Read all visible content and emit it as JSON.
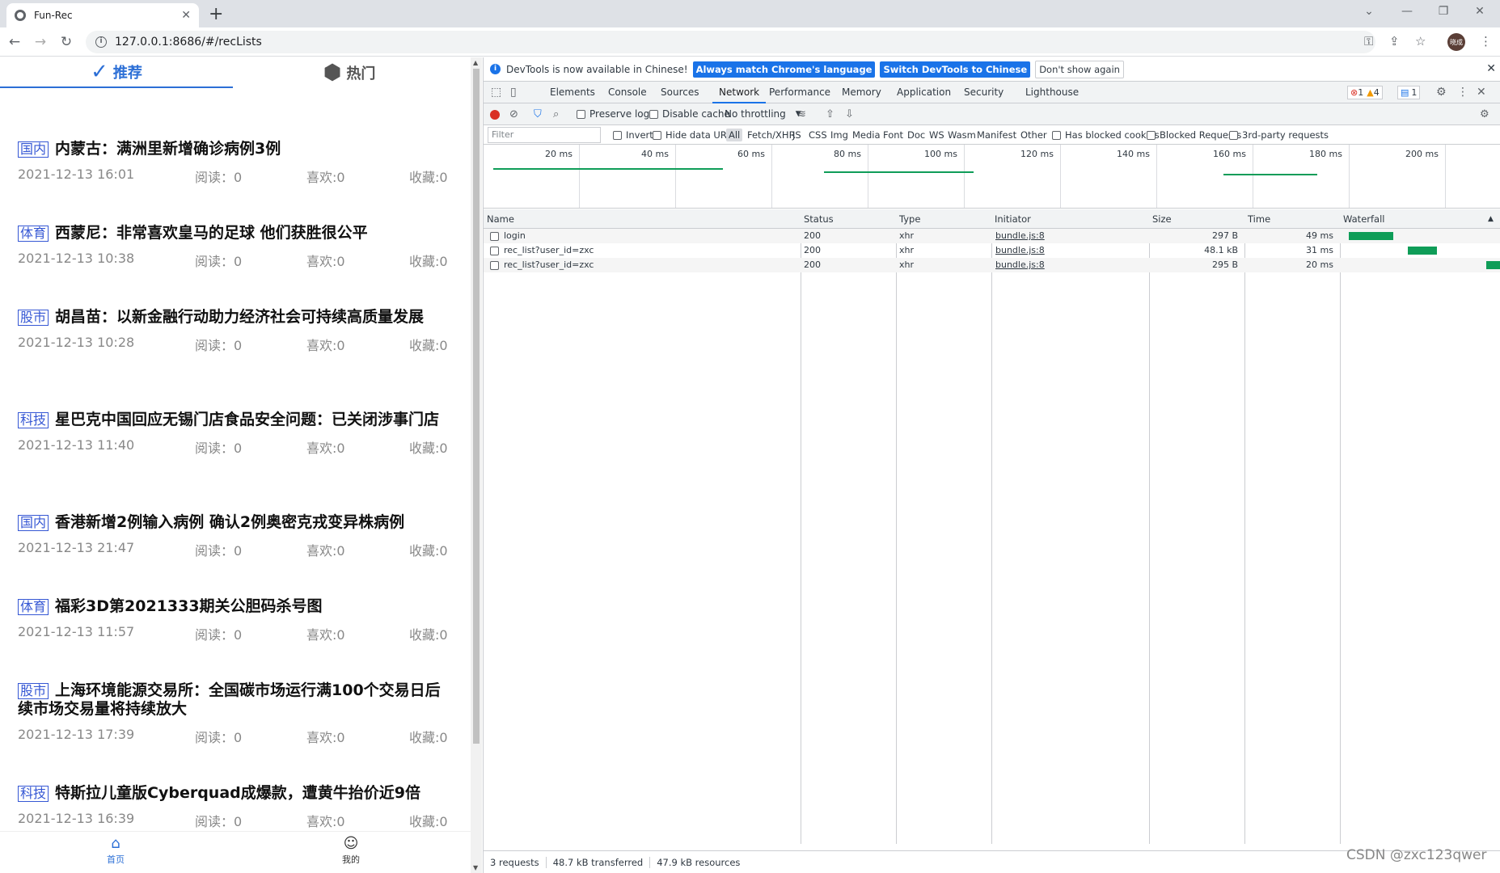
{
  "browser": {
    "tab_title": "Fun-Rec",
    "url": "127.0.0.1:8686/#/recLists",
    "avatar_text": "晓成"
  },
  "app": {
    "tabs": [
      {
        "label": "推荐",
        "active": true
      },
      {
        "label": "热门",
        "active": false
      }
    ],
    "news": [
      {
        "category": "国内",
        "title": "内蒙古：满洲里新增确诊病例3例",
        "date": "2021-12-13 16:01",
        "read": "阅读：0",
        "like": "喜欢:0",
        "fav": "收藏:0"
      },
      {
        "category": "体育",
        "title": "西蒙尼：非常喜欢皇马的足球 他们获胜很公平",
        "date": "2021-12-13 10:38",
        "read": "阅读：0",
        "like": "喜欢:0",
        "fav": "收藏:0"
      },
      {
        "category": "股市",
        "title": "胡昌苗：以新金融行动助力经济社会可持续高质量发展",
        "date": "2021-12-13 10:28",
        "read": "阅读：0",
        "like": "喜欢:0",
        "fav": "收藏:0"
      },
      {
        "category": "科技",
        "title": "星巴克中国回应无锡门店食品安全问题：已关闭涉事门店",
        "date": "2021-12-13 11:40",
        "read": "阅读：0",
        "like": "喜欢:0",
        "fav": "收藏:0"
      },
      {
        "category": "国内",
        "title": "香港新增2例输入病例 确认2例奥密克戎变异株病例",
        "date": "2021-12-13 21:47",
        "read": "阅读：0",
        "like": "喜欢:0",
        "fav": "收藏:0"
      },
      {
        "category": "体育",
        "title": "福彩3D第2021333期关公胆码杀号图",
        "date": "2021-12-13 11:57",
        "read": "阅读：0",
        "like": "喜欢:0",
        "fav": "收藏:0"
      },
      {
        "category": "股市",
        "title": "上海环境能源交易所：全国碳市场运行满100个交易日后续市场交易量将持续放大",
        "date": "2021-12-13 17:39",
        "read": "阅读：0",
        "like": "喜欢:0",
        "fav": "收藏:0"
      },
      {
        "category": "科技",
        "title": "特斯拉儿童版Cyberquad成爆款，遭黄牛抬价近9倍",
        "date": "2021-12-13 16:39",
        "read": "阅读：0",
        "like": "喜欢:0",
        "fav": "收藏:0"
      }
    ],
    "bottom_nav": [
      {
        "label": "首页",
        "active": true
      },
      {
        "label": "我的",
        "active": false
      }
    ]
  },
  "devtools": {
    "infobar": {
      "message": "DevTools is now available in Chinese!",
      "btn_match": "Always match Chrome's language",
      "btn_switch": "Switch DevTools to Chinese",
      "btn_dismiss": "Don't show again"
    },
    "tabs": [
      "Elements",
      "Console",
      "Sources",
      "Network",
      "Performance",
      "Memory",
      "Application",
      "Security",
      "Lighthouse"
    ],
    "active_tab": "Network",
    "badges": {
      "errors": "1",
      "warnings": "4",
      "messages": "1"
    },
    "network_toolbar": {
      "preserve_log": "Preserve log",
      "disable_cache": "Disable cache",
      "throttling": "No throttling"
    },
    "filter_bar": {
      "placeholder": "Filter",
      "invert": "Invert",
      "hide_data_urls": "Hide data URLs",
      "types": [
        "All",
        "Fetch/XHR",
        "JS",
        "CSS",
        "Img",
        "Media",
        "Font",
        "Doc",
        "WS",
        "Wasm",
        "Manifest",
        "Other"
      ],
      "has_blocked_cookies": "Has blocked cookies",
      "blocked_requests": "Blocked Requests",
      "third_party": "3rd-party requests"
    },
    "overview_ticks": [
      "20 ms",
      "40 ms",
      "60 ms",
      "80 ms",
      "100 ms",
      "120 ms",
      "140 ms",
      "160 ms",
      "180 ms",
      "200 ms"
    ],
    "columns": [
      "Name",
      "Status",
      "Type",
      "Initiator",
      "Size",
      "Time",
      "Waterfall"
    ],
    "requests": [
      {
        "name": "login",
        "status": "200",
        "type": "xhr",
        "initiator": "bundle.js:8",
        "size": "297 B",
        "time": "49 ms"
      },
      {
        "name": "rec_list?user_id=zxc",
        "status": "200",
        "type": "xhr",
        "initiator": "bundle.js:8",
        "size": "48.1 kB",
        "time": "31 ms"
      },
      {
        "name": "rec_list?user_id=zxc",
        "status": "200",
        "type": "xhr",
        "initiator": "bundle.js:8",
        "size": "295 B",
        "time": "20 ms"
      }
    ],
    "status": {
      "requests": "3 requests",
      "transferred": "48.7 kB transferred",
      "resources": "47.9 kB resources"
    }
  },
  "watermark": "CSDN @zxc123qwer"
}
